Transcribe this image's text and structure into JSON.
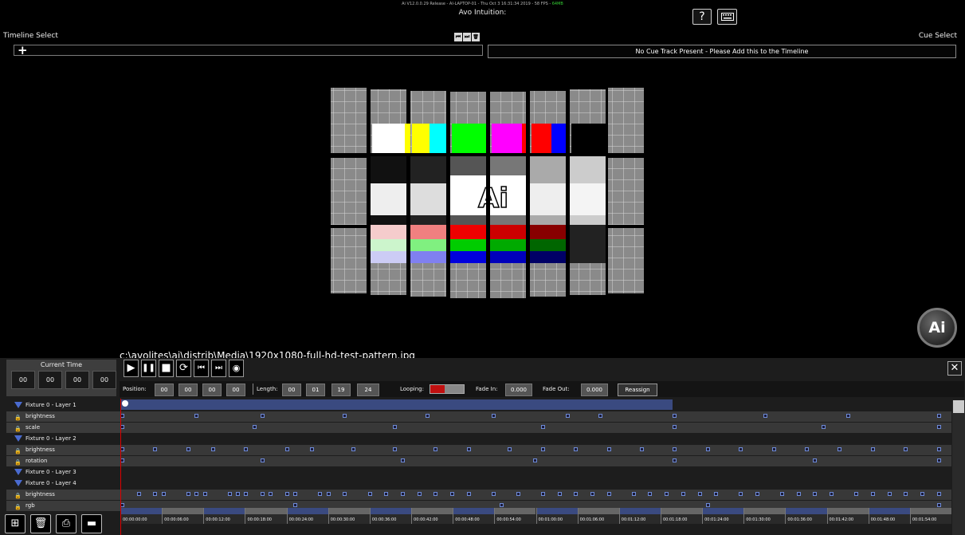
{
  "system_bar": {
    "text": "Ai V12.0.0.29 Release - AI-LAPTOP-01 - Thu Oct  3 16:31:34 2019 - 58 FPS - ",
    "fps_status": "64MB"
  },
  "app_title": "Avo Intuition:",
  "help_icon": "?",
  "timeline_select": {
    "label": "Timeline Select",
    "add_glyph": "+"
  },
  "transport_top": [
    "⏮",
    "⏭",
    "🗑"
  ],
  "cue_select": {
    "label": "Cue Select",
    "message": "No Cue Track Present - Please Add this to the Timeline"
  },
  "file_path": "c:\\avolites\\ai\\distrib\\Media\\1920x1080-full-hd-test-pattern.jpg",
  "logo_text": "Ai",
  "current_time": {
    "label": "Current Time",
    "values": [
      "00",
      "00",
      "00",
      "00"
    ]
  },
  "transport": [
    "▶",
    "❚❚",
    "■",
    "⟳",
    "⏮",
    "⏭",
    "◉"
  ],
  "close_glyph": "✕",
  "controls": {
    "position_label": "Position:",
    "position": [
      "00",
      "00",
      "00",
      "00"
    ],
    "length_label": "Length:",
    "length": [
      "00",
      "01",
      "19",
      "24"
    ],
    "looping_label": "Looping:",
    "fade_in_label": "Fade In:",
    "fade_in": "0.000",
    "fade_out_label": "Fade Out:",
    "fade_out": "0.000",
    "reassign": "Reassign"
  },
  "tracks": [
    {
      "type": "header",
      "label": "Fixture 0 - Layer 1",
      "marks": []
    },
    {
      "type": "row",
      "label": "brightness",
      "marks": [
        0.0,
        0.09,
        0.17,
        0.27,
        0.37,
        0.45,
        0.54,
        0.58,
        0.67,
        0.78,
        0.88,
        0.99
      ]
    },
    {
      "type": "row",
      "label": "scale",
      "marks": [
        0.0,
        0.16,
        0.33,
        0.51,
        0.67,
        0.85,
        0.99
      ]
    },
    {
      "type": "header",
      "label": "Fixture 0 - Layer 2",
      "marks": []
    },
    {
      "type": "row",
      "label": "brightness",
      "marks": [
        0.0,
        0.04,
        0.08,
        0.11,
        0.15,
        0.2,
        0.23,
        0.28,
        0.33,
        0.38,
        0.42,
        0.47,
        0.51,
        0.55,
        0.59,
        0.63,
        0.67,
        0.71,
        0.75,
        0.79,
        0.83,
        0.87,
        0.91,
        0.95,
        0.99
      ]
    },
    {
      "type": "row",
      "label": "rotation",
      "marks": [
        0.0,
        0.17,
        0.34,
        0.5,
        0.67,
        0.84,
        0.99
      ]
    },
    {
      "type": "header",
      "label": "Fixture 0 - Layer 3",
      "marks": []
    },
    {
      "type": "header",
      "label": "Fixture 0 - Layer 4",
      "marks": []
    },
    {
      "type": "row",
      "label": "brightness",
      "marks": [
        0.02,
        0.04,
        0.05,
        0.08,
        0.09,
        0.1,
        0.13,
        0.14,
        0.15,
        0.17,
        0.18,
        0.2,
        0.21,
        0.24,
        0.25,
        0.27,
        0.3,
        0.32,
        0.34,
        0.36,
        0.38,
        0.4,
        0.42,
        0.45,
        0.48,
        0.51,
        0.53,
        0.55,
        0.57,
        0.59,
        0.62,
        0.64,
        0.66,
        0.68,
        0.7,
        0.72,
        0.75,
        0.77,
        0.8,
        0.82,
        0.84,
        0.86,
        0.89,
        0.91,
        0.93,
        0.95,
        0.97,
        0.99
      ]
    },
    {
      "type": "row",
      "label": "rgb",
      "marks": [
        0.0,
        0.21,
        0.46,
        0.71,
        0.99
      ]
    }
  ],
  "ruler": [
    "00:00:00:00",
    "00:00:06:00",
    "00:00:12:00",
    "00:00:18:00",
    "00:00:24:00",
    "00:00:30:00",
    "00:00:36:00",
    "00:00:42:00",
    "00:00:48:00",
    "00:00:54:00",
    "00:01:00:00",
    "00:01:06:00",
    "00:01:12:00",
    "00:01:18:00",
    "00:01:24:00",
    "00:01:30:00",
    "00:01:36:00",
    "00:01:42:00",
    "00:01:48:00",
    "00:01:54:00"
  ],
  "bottom_buttons": [
    "⊞",
    "🗑",
    "⎙",
    "▬"
  ],
  "colors": {
    "accent": "#4a6bd0",
    "looping": "#c01010",
    "playhead": "#dd0000"
  }
}
